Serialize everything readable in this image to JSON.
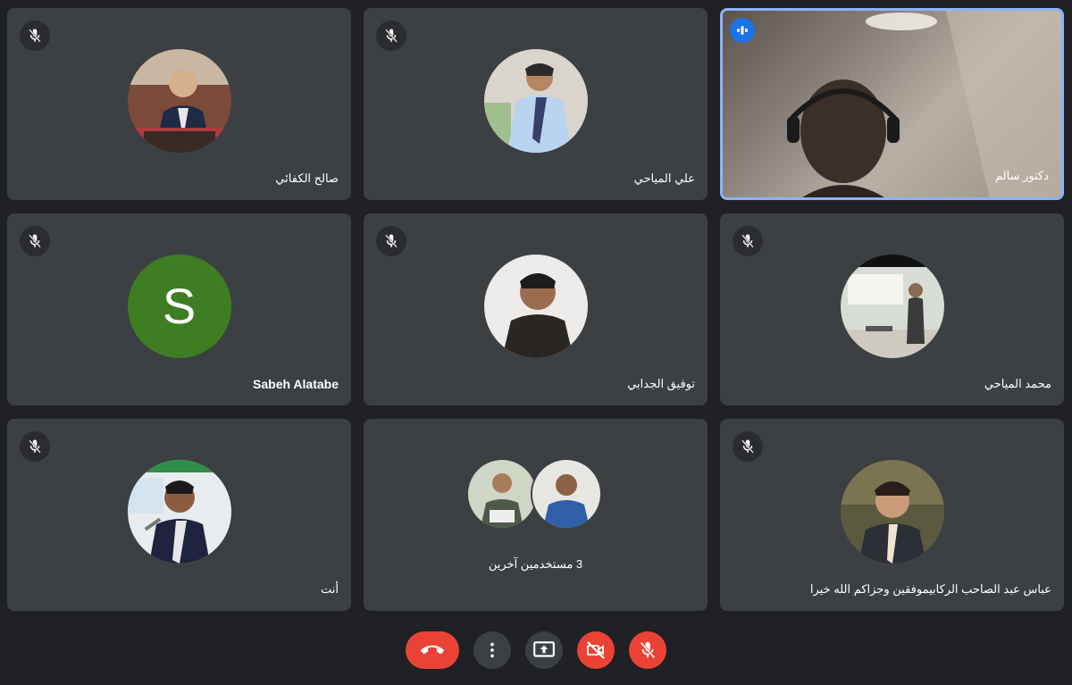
{
  "participants": [
    {
      "name": "صالح الكفائي",
      "muted": true
    },
    {
      "name": "علي المياحي",
      "muted": true
    },
    {
      "name": "دكتور سالم",
      "muted": false,
      "speaking": true
    },
    {
      "name": "Sabeh Alatabe",
      "muted": true,
      "initial": "S"
    },
    {
      "name": "توفيق الجدابي",
      "muted": true
    },
    {
      "name": "محمد المياحي",
      "muted": true
    },
    {
      "name": "أنت",
      "muted": true
    },
    {
      "name": "3 مستخدمين آخرين",
      "group": true
    },
    {
      "name": "عباس عبد الصاحب الركابيموفقين وجزاكم الله خيرا",
      "muted": true
    }
  ],
  "controls": {
    "hangup": "call-end-icon",
    "more": "more-vert-icon",
    "present": "present-screen-icon",
    "camera": "videocam-off-icon",
    "mic": "mic-off-icon"
  },
  "colors": {
    "background": "#202124",
    "tile": "#3c4043",
    "active_border": "#8ab4f8",
    "danger": "#ea4335",
    "speaking": "#1a73e8",
    "letter_avatar": "#3f7d23"
  }
}
